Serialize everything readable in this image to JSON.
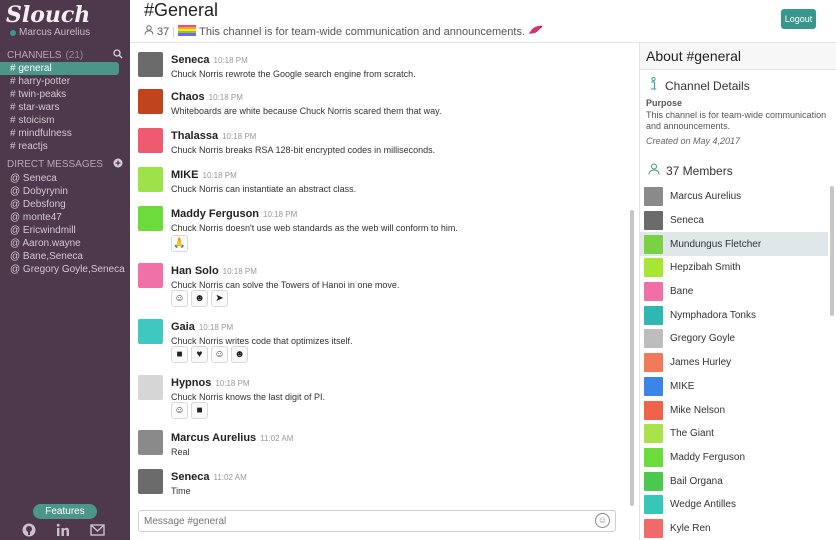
{
  "app": {
    "logo": "Slouch",
    "current_user": "Marcus Aurelius"
  },
  "sidebar": {
    "channels_label": "CHANNELS",
    "channels_count": "(21)",
    "channels": [
      "# general",
      "# harry-potter",
      "# twin-peaks",
      "# star-wars",
      "# stoicism",
      "# mindfulness",
      "# reactjs"
    ],
    "dm_label": "DIRECT MESSAGES",
    "dms": [
      "@ Seneca",
      "@ Dobyrynin",
      "@ Debsfong",
      "@ monte47",
      "@ Ericwindmill",
      "@ Aaron.wayne",
      "@ Bane,Seneca",
      "@ Gregory Goyle,Seneca"
    ],
    "features_label": "Features"
  },
  "header": {
    "title": "#General",
    "member_count": "37",
    "topic": "This channel is for team-wide communication and announcements.",
    "logout_label": "Logout"
  },
  "messages": [
    {
      "name": "Seneca",
      "time": "10:18 PM",
      "text": "Chuck Norris rewrote the Google search engine from scratch.",
      "color": "#6b6b6b"
    },
    {
      "name": "Chaos",
      "time": "10:18 PM",
      "text": "Whiteboards are white because Chuck Norris scared them that way.",
      "color": "#c1441c"
    },
    {
      "name": "Thalassa",
      "time": "10:18 PM",
      "text": "Chuck Norris breaks RSA 128-bit encrypted codes in milliseconds.",
      "color": "#ee5a6f"
    },
    {
      "name": "MIKE",
      "time": "10:18 PM",
      "text": "Chuck Norris can instantiate an abstract class.",
      "color": "#9ee24a"
    },
    {
      "name": "Maddy Ferguson",
      "time": "10:18 PM",
      "text": "Chuck Norris doesn't use web standards as the web will conform to him.",
      "color": "#6cdc3c"
    },
    {
      "name": "Han Solo",
      "time": "10:18 PM",
      "text": "Chuck Norris can solve the Towers of Hanoi in one move.",
      "color": "#f070a8"
    },
    {
      "name": "Gaia",
      "time": "10:18 PM",
      "text": "Chuck Norris writes code that optimizes itself.",
      "color": "#3fc7c0"
    },
    {
      "name": "Hypnos",
      "time": "10:18 PM",
      "text": "Chuck Norris knows the last digit of PI.",
      "color": "#d6d6d6"
    },
    {
      "name": "Marcus Aurelius",
      "time": "11:02 AM",
      "text": "Real",
      "color": "#8a8a8a"
    },
    {
      "name": "Seneca",
      "time": "11:02 AM",
      "text": "Time",
      "color": "#6b6b6b"
    }
  ],
  "composer": {
    "placeholder": "Message #general"
  },
  "right_panel": {
    "title": "About #general",
    "details_label": "Channel Details",
    "purpose_label": "Purpose",
    "purpose_text": "This channel is for team-wide communication and announcements.",
    "created_text": "Created on May 4,2017",
    "members_label": "37 Members",
    "members": [
      {
        "name": "Marcus Aurelius",
        "color": "#8a8a8a"
      },
      {
        "name": "Seneca",
        "color": "#6b6b6b"
      },
      {
        "name": "Mundungus Fletcher",
        "color": "#7bd144"
      },
      {
        "name": "Hepzibah Smith",
        "color": "#a8e636"
      },
      {
        "name": "Bane",
        "color": "#f06fa5"
      },
      {
        "name": "Nymphadora Tonks",
        "color": "#2fb8b0"
      },
      {
        "name": "Gregory Goyle",
        "color": "#bdbdbd"
      },
      {
        "name": "James Hurley",
        "color": "#f07a5a"
      },
      {
        "name": "MIKE",
        "color": "#3a86e8"
      },
      {
        "name": "Mike Nelson",
        "color": "#f0624a"
      },
      {
        "name": "The Giant",
        "color": "#a9e24a"
      },
      {
        "name": "Maddy Ferguson",
        "color": "#6cdc3c"
      },
      {
        "name": "Bail Organa",
        "color": "#4ac850"
      },
      {
        "name": "Wedge Antilles",
        "color": "#36c7b8"
      },
      {
        "name": "Kyle Ren",
        "color": "#f06a6a"
      }
    ]
  },
  "colors": {
    "sidebar": "#4d394b",
    "accent": "#4c9689"
  }
}
